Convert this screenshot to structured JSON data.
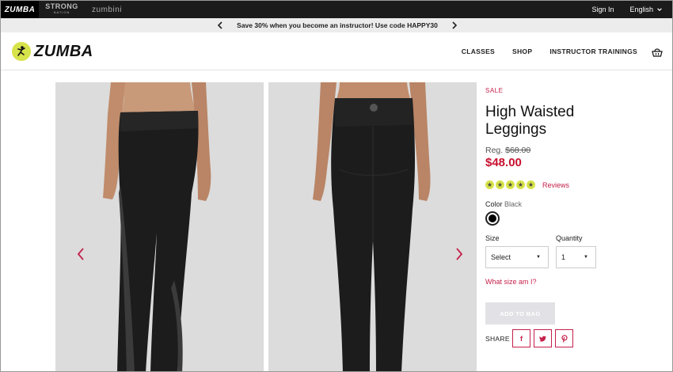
{
  "topbar": {
    "brand_zumba": "ZUMBA",
    "brand_strong": "STRONG",
    "brand_strong_sub": "NATION",
    "brand_zumbini": "zumbini",
    "sign_in": "Sign In",
    "language": "English"
  },
  "promo": {
    "text": "Save 30% when you become an instructor! Use code HAPPY30"
  },
  "header": {
    "logo_text": "ZUMBA",
    "nav": {
      "classes": "CLASSES",
      "shop": "SHOP",
      "trainings": "INSTRUCTOR TRAININGS"
    }
  },
  "product": {
    "badge": "SALE",
    "title": "High Waisted Leggings",
    "reg_label": "Reg.",
    "reg_price": "$68.00",
    "price": "$48.00",
    "rating_stars": 5,
    "reviews_label": "Reviews",
    "color_label": "Color",
    "color_value": "Black",
    "size_label": "Size",
    "size_value": "Select",
    "quantity_label": "Quantity",
    "quantity_value": "1",
    "size_guide": "What size am I?",
    "add_to_bag": "ADD TO BAG",
    "share_label": "SHARE"
  },
  "colors": {
    "accent": "#c4204a",
    "price": "#c8102e",
    "brand_yellow": "#d7e34a"
  }
}
